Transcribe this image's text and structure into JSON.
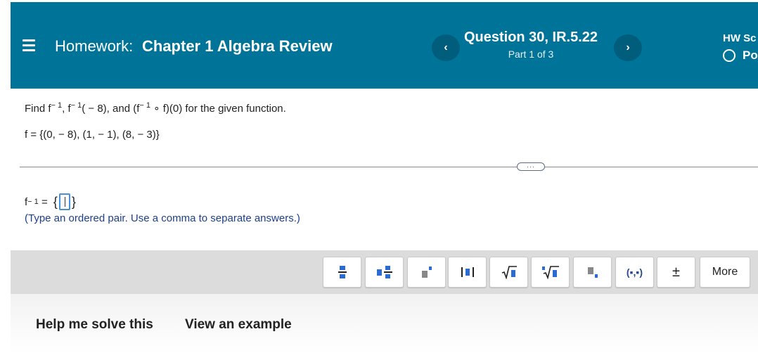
{
  "header": {
    "homework_label": "Homework:",
    "homework_title": "Chapter 1 Algebra Review",
    "question_title": "Question 30, IR.5.22",
    "question_part": "Part 1 of 3",
    "prev_label": "‹",
    "next_label": "›",
    "score_label": "HW Sc",
    "points_label": "Po",
    "accent_color": "#007398"
  },
  "question": {
    "find_prefix": "Find f",
    "sup1": "− 1",
    "mid1": ", f",
    "sup2": "− 1",
    "mid2": "( − 8), and (f",
    "sup3": "− 1",
    "suffix": " ∘ f)(0) for the given function.",
    "function_definition": "f = {(0, − 8), (1, − 1), (8, − 3)}"
  },
  "expand_label": "···",
  "answer": {
    "lhs_base": "f",
    "lhs_sup": "− 1",
    "equals": " = ",
    "open_brace": "{",
    "close_brace": "}",
    "value": "",
    "hint": "(Type an ordered pair. Use a comma to separate answers.)"
  },
  "toolbar": {
    "tools": [
      "fraction",
      "mixed-number",
      "exponent",
      "absolute-value",
      "square-root",
      "nth-root",
      "subscript",
      "ordered-pair",
      "plus-minus"
    ],
    "abs_label": "|▪|",
    "pair_label": "(▪,▪)",
    "plus_minus_label": "±",
    "more_label": "More"
  },
  "footer": {
    "help_label": "Help me solve this",
    "example_label": "View an example"
  }
}
